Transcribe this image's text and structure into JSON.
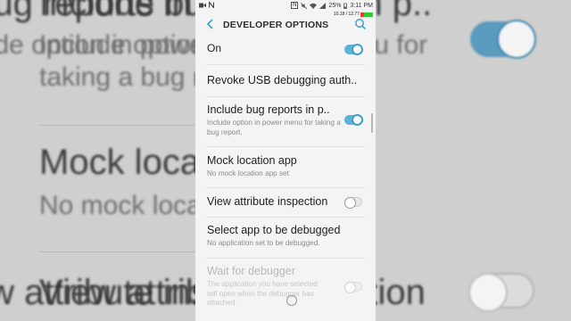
{
  "background": {
    "lines": [
      {
        "text": "Include bug reports in p.."
      },
      {
        "text": "Include option in power menu for"
      },
      {
        "text": "taking a bug report."
      },
      {
        "text": "Mock location app"
      },
      {
        "text": "No mock location app set"
      },
      {
        "text": "View attribute inspection"
      }
    ]
  },
  "statusbar": {
    "left_icons": [
      "video-icon",
      "notification-n-icon"
    ],
    "nfc": "N",
    "battery": "25%",
    "time": "3:11 PM",
    "net_speed": "10.18 / 12.77"
  },
  "appbar": {
    "title": "DEVELOPER OPTIONS"
  },
  "settings": [
    {
      "title": "On",
      "subtitle": "",
      "toggle": "on",
      "enabled": true
    },
    {
      "title": "Revoke USB debugging auth..",
      "subtitle": "",
      "toggle": "none",
      "enabled": true
    },
    {
      "title": "Include bug reports in p..",
      "subtitle": "Include option in power menu for taking a bug report.",
      "toggle": "on",
      "enabled": true
    },
    {
      "title": "Mock location app",
      "subtitle": "No mock location app set",
      "toggle": "none",
      "enabled": true
    },
    {
      "title": "View attribute inspection",
      "subtitle": "",
      "toggle": "off",
      "enabled": true
    },
    {
      "title": "Select app to be debugged",
      "subtitle": "No application set to be debugged.",
      "toggle": "none",
      "enabled": true
    },
    {
      "title": "Wait for debugger",
      "subtitle": "The application you have selected will open when the debugger has attached.",
      "toggle": "off",
      "enabled": false
    }
  ],
  "colors": {
    "accent": "#3e9fcf",
    "toggle_track_on": "#5fb3d6",
    "screen_bg": "#f4f4f4"
  }
}
